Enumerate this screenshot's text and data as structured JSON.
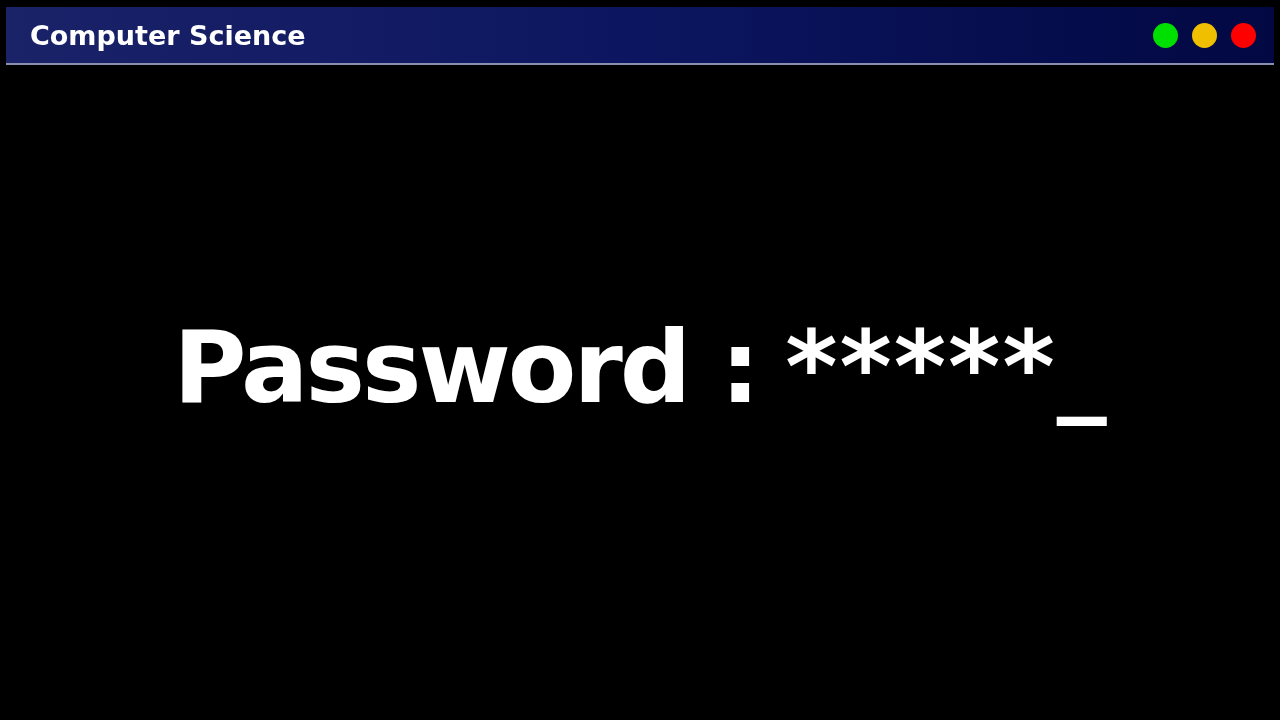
{
  "window": {
    "title": "Computer Science",
    "buttons": [
      {
        "color": "#00e000"
      },
      {
        "color": "#f0c000"
      },
      {
        "color": "#ff0000"
      }
    ]
  },
  "prompt": {
    "label": "Password :",
    "value": "*****",
    "cursor": "_"
  }
}
